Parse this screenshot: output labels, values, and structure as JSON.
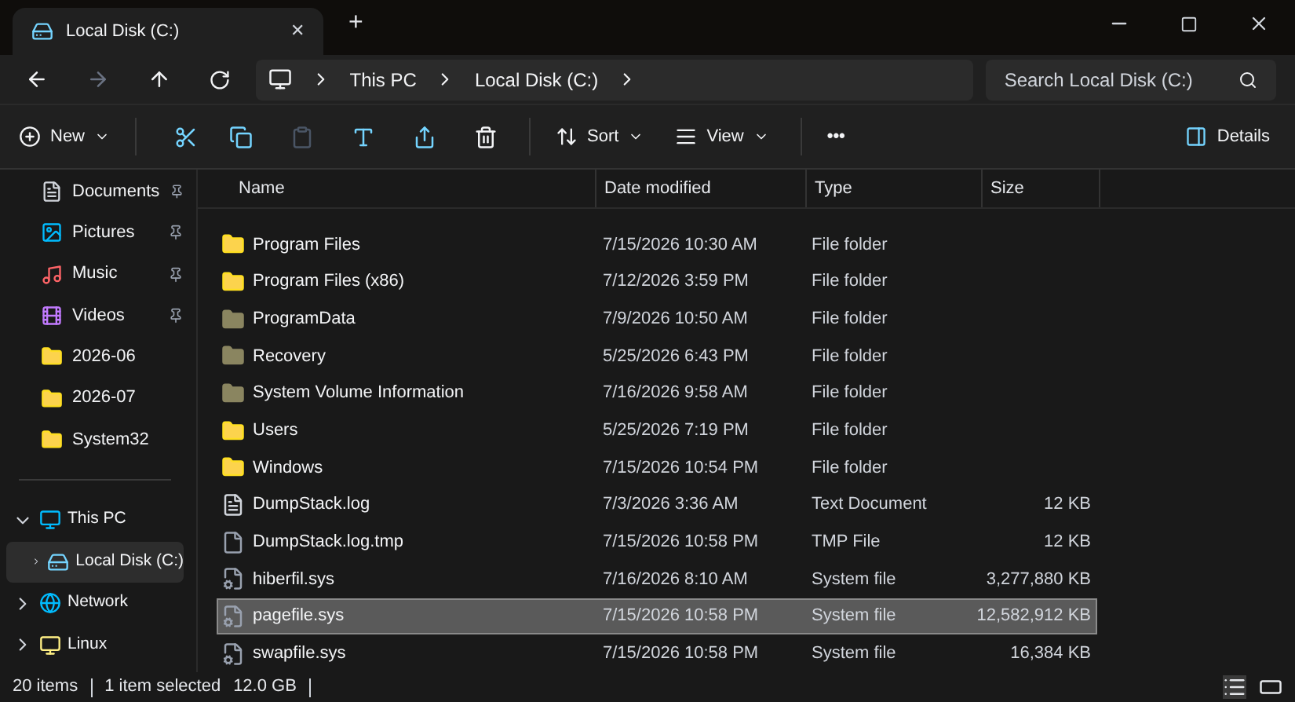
{
  "tab": {
    "title": "Local Disk (C:)",
    "close": "✕",
    "new_tab": "+"
  },
  "address": {
    "crumbs": [
      "This PC",
      "Local Disk (C:)"
    ],
    "search_placeholder": "Search Local Disk (C:)"
  },
  "toolbar": {
    "new": "New",
    "sort": "Sort",
    "view": "View",
    "more": "•••",
    "details": "Details"
  },
  "sidebar": {
    "quick": [
      {
        "label": "Documents",
        "kind": "documents",
        "pinned": true
      },
      {
        "label": "Pictures",
        "kind": "pictures",
        "pinned": true
      },
      {
        "label": "Music",
        "kind": "music",
        "pinned": true
      },
      {
        "label": "Videos",
        "kind": "videos",
        "pinned": true
      },
      {
        "label": "2026-06",
        "kind": "folder",
        "pinned": false
      },
      {
        "label": "2026-07",
        "kind": "folder",
        "pinned": false
      },
      {
        "label": "System32",
        "kind": "folder",
        "pinned": false
      }
    ],
    "tree": [
      {
        "label": "This PC",
        "kind": "pc",
        "expanded": true,
        "selected": false,
        "children": [
          {
            "label": "Local Disk (C:)",
            "kind": "disk",
            "expanded": false,
            "selected": true
          }
        ]
      },
      {
        "label": "Network",
        "kind": "network",
        "expanded": false,
        "selected": false
      },
      {
        "label": "Linux",
        "kind": "linux",
        "expanded": false,
        "selected": false
      }
    ]
  },
  "table": {
    "columns": [
      "Name",
      "Date modified",
      "Type",
      "Size"
    ],
    "rows": [
      {
        "kind": "folder",
        "name": "Program Files",
        "date": "7/15/2026 10:30 AM",
        "type": "File folder",
        "selected": false
      },
      {
        "kind": "folder",
        "name": "Program Files (x86)",
        "date": "7/12/2026 3:59 PM",
        "type": "File folder",
        "selected": false
      },
      {
        "kind": "hidden-folder",
        "name": "ProgramData",
        "date": "7/9/2026 10:50 AM",
        "type": "File folder",
        "selected": false
      },
      {
        "kind": "hidden-folder",
        "name": "Recovery",
        "date": "5/25/2026 6:43 PM",
        "type": "File folder",
        "selected": false
      },
      {
        "kind": "hidden-folder",
        "name": "System Volume Information",
        "date": "7/16/2026 9:58 AM",
        "type": "File folder",
        "selected": false
      },
      {
        "kind": "folder",
        "name": "Users",
        "date": "5/25/2026 7:19 PM",
        "type": "File folder",
        "selected": false
      },
      {
        "kind": "folder",
        "name": "Windows",
        "date": "7/15/2026 10:54 PM",
        "type": "File folder",
        "selected": false
      },
      {
        "kind": "text",
        "name": "DumpStack.log",
        "date": "7/3/2026 3:36 AM",
        "type": "Text Document",
        "size": "12 KB",
        "selected": false
      },
      {
        "kind": "file",
        "name": "DumpStack.log.tmp",
        "date": "7/15/2026 10:58 PM",
        "type": "TMP File",
        "size": "12 KB",
        "selected": false
      },
      {
        "kind": "system",
        "name": "hiberfil.sys",
        "date": "7/16/2026 8:10 AM",
        "type": "System file",
        "size": "3,277,880 KB",
        "selected": false
      },
      {
        "kind": "system",
        "name": "pagefile.sys",
        "date": "7/15/2026 10:58 PM",
        "type": "System file",
        "size": "12,582,912 KB",
        "selected": true
      },
      {
        "kind": "system",
        "name": "swapfile.sys",
        "date": "7/15/2026 10:58 PM",
        "type": "System file",
        "size": "16,384 KB",
        "selected": false
      }
    ]
  },
  "status_bar": {
    "count": "20 items",
    "selection": "1 item selected",
    "size": "12.0 GB"
  }
}
